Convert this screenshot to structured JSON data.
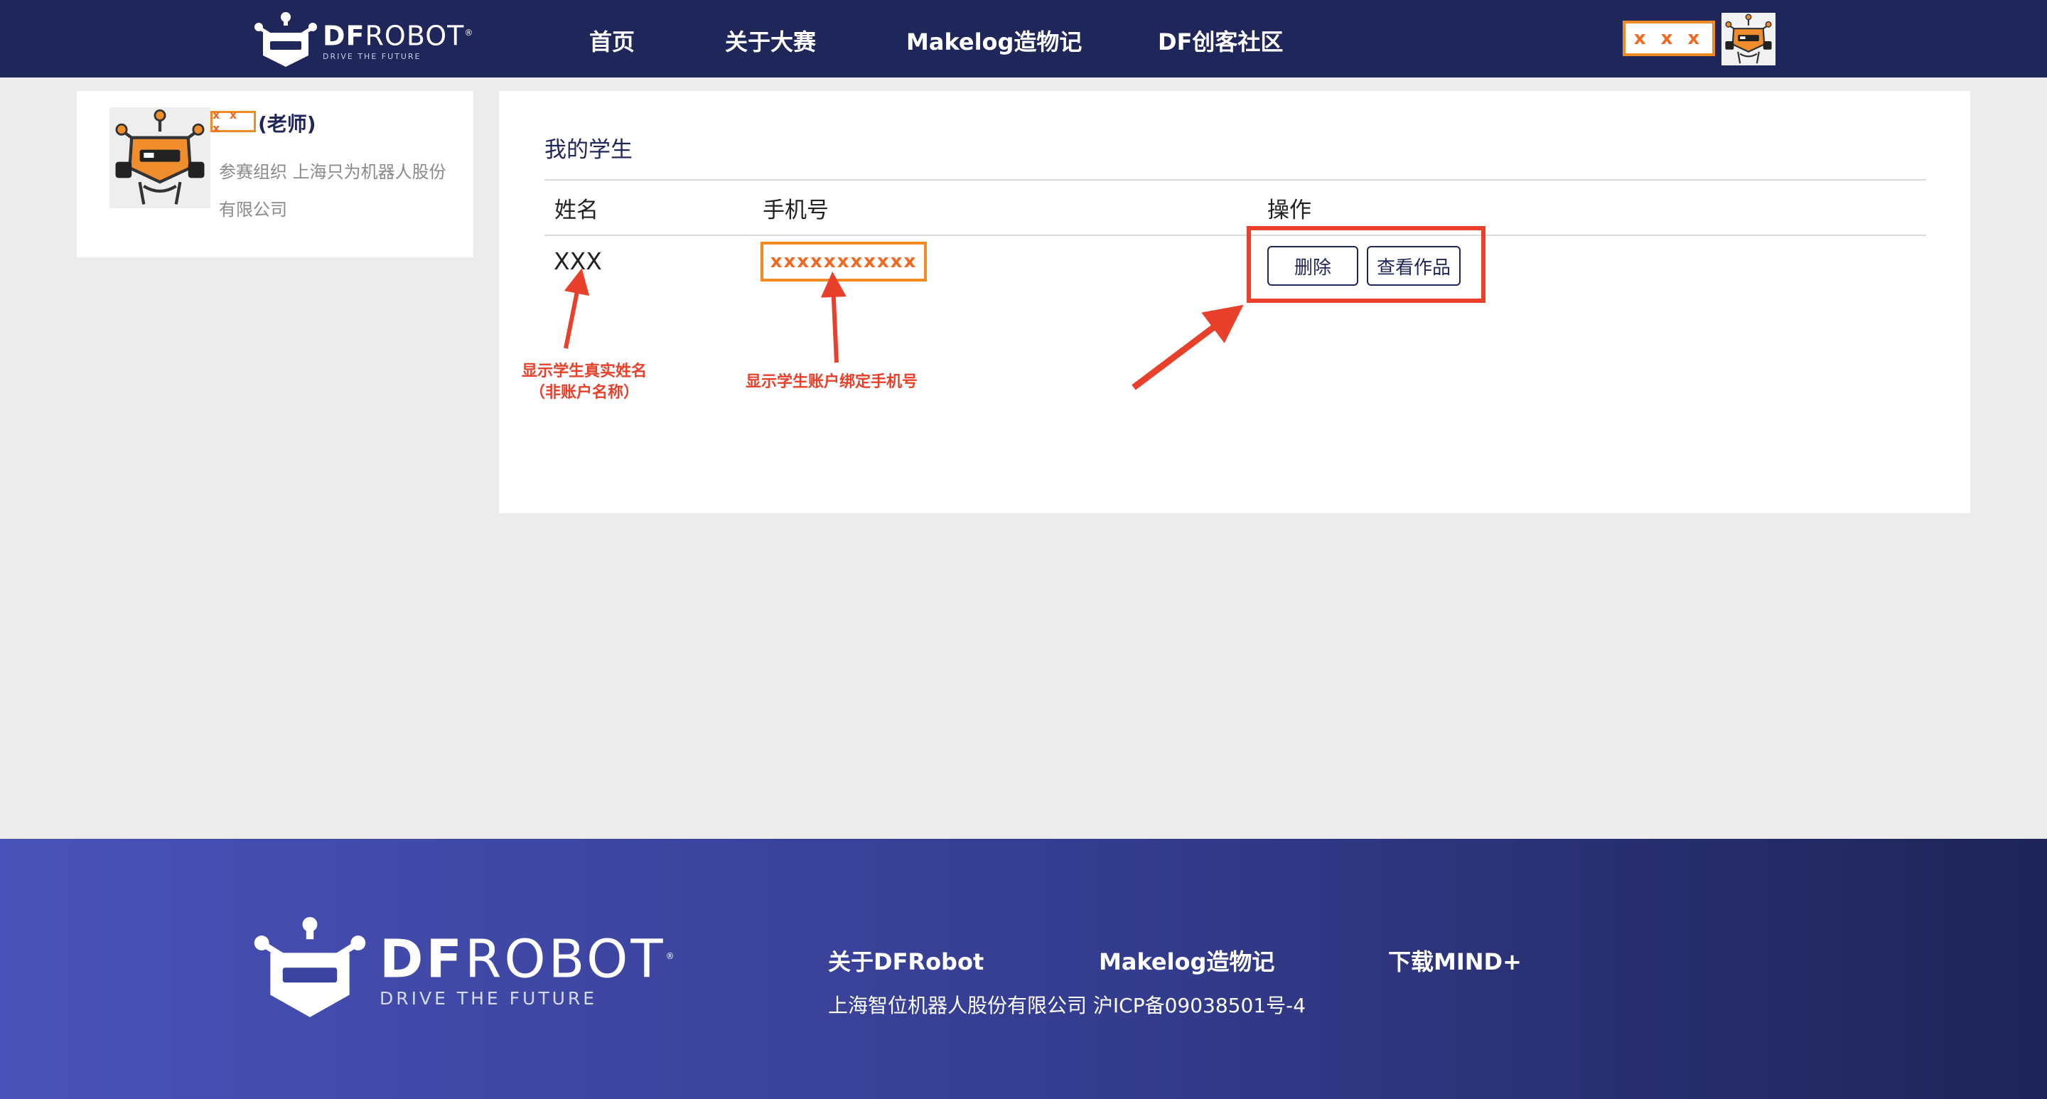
{
  "header": {
    "logo": {
      "brand_bold": "DF",
      "brand_rest": "ROBOT",
      "tagline": "DRIVE THE FUTURE"
    },
    "nav": [
      {
        "label": "首页"
      },
      {
        "label": "关于大赛"
      },
      {
        "label": "Makelog造物记"
      },
      {
        "label": "DF创客社区"
      }
    ],
    "user_name": "x x x"
  },
  "profile": {
    "name": "x x x",
    "role": "(老师)",
    "org": "参赛组织 上海只为机器人股份有限公司"
  },
  "main": {
    "title": "我的学生",
    "columns": [
      "姓名",
      "手机号",
      "操作"
    ],
    "rows": [
      {
        "name": "XXX",
        "phone": "xxxxxxxxxxx"
      }
    ],
    "actions": {
      "delete": "删除",
      "view_works": "查看作品"
    }
  },
  "annotations": {
    "name_note_line1": "显示学生真实姓名",
    "name_note_line2": "（非账户名称）",
    "phone_note": "显示学生账户绑定手机号"
  },
  "footer": {
    "logo": {
      "brand_bold": "DF",
      "brand_rest": "ROBOT",
      "tagline": "DRIVE THE FUTURE"
    },
    "links": [
      {
        "label": "关于DFRobot"
      },
      {
        "label": "Makelog造物记"
      },
      {
        "label": "下载MIND+"
      }
    ],
    "copyright": "上海智位机器人股份有限公司 沪ICP备09038501号-4"
  },
  "colors": {
    "header_bg": "#1f2659",
    "highlight_orange": "#ef8a25",
    "annotation_red": "#e8402a",
    "footer_gradient_start": "#4952b8",
    "footer_gradient_end": "#1e2457"
  }
}
